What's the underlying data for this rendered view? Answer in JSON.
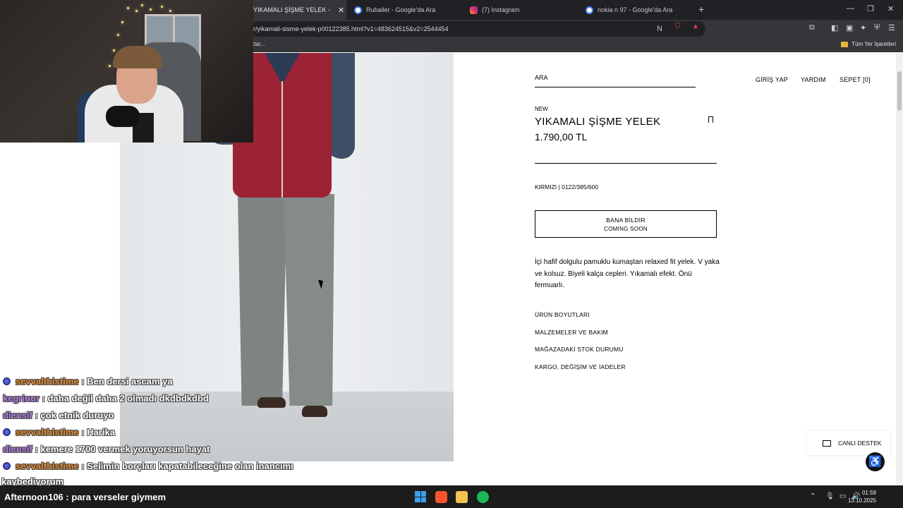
{
  "browser": {
    "tabs": [
      {
        "title": "YIKAMALI ŞİŞME YELEK - Kırmızı",
        "active": true
      },
      {
        "title": "Rubailer - Google'da Ara",
        "active": false
      },
      {
        "title": "(7) Instagram",
        "active": false
      },
      {
        "title": "nokia n 97 - Google'da Ara",
        "active": false
      }
    ],
    "new_tab": "+",
    "url": "r/yikamali-sisme-yelek-p00122385.html?v1=483624515&v2=2544454",
    "bookmark_left": "ttar...",
    "bookmarks_folder": "Tüm Yer İşaretleri"
  },
  "product": {
    "search_label": "ARA",
    "nav": {
      "login": "GİRİŞ YAP",
      "help": "YARDIM",
      "cart": "SEPET [0]"
    },
    "tag": "NEW",
    "title": "YIKAMALI ŞİŞME YELEK",
    "price": "1.790,00 TL",
    "color_code": "KIRMIZI | 0122/385/600",
    "notify_line1": "BANA BİLDİR",
    "notify_line2": "COMING SOON",
    "description": "İçi hafif dolgulu pamuklu kumaştan relaxed fit yelek. V yaka ve kolsuz. Biyeli kalça cepleri. Yıkamalı efekt. Önü fermuarlı.",
    "accordion": [
      "ÜRÜN BOYUTLARI",
      "MALZEMELER VE BAKIM",
      "MAĞAZADAKİ STOK DURUMU",
      "KARGO, DEĞİŞİM VE İADELER"
    ],
    "support_label": "CANLI DESTEK"
  },
  "chat": [
    {
      "user": "sevvalthistime",
      "msg": ": Ben dersi ascam ya",
      "badge": true,
      "color": "orange"
    },
    {
      "user": "kegrinur",
      "msg": ": daha değil daha 2 olmadı dkdbdkdbd",
      "badge": false,
      "color": "purple"
    },
    {
      "user": "diensif",
      "msg": ": çok etnik duruyo",
      "badge": false,
      "color": "purple"
    },
    {
      "user": "sevvalthistime",
      "msg": ": Harika",
      "badge": true,
      "color": "orange"
    },
    {
      "user": "diensif",
      "msg": ": kemere 1700 vermek yoruyorsun hayat",
      "badge": false,
      "color": "purple"
    },
    {
      "user": "sevvalthistime",
      "msg": ": Selimin borçları kapatabileceğine olan inancımı",
      "badge": true,
      "color": "orange"
    },
    {
      "user": "",
      "msg": "kaybediyorum",
      "badge": false,
      "color": "white"
    }
  ],
  "taskbar": {
    "chat_user": "Afternoon106",
    "chat_msg": " : para verseler giymem",
    "time": "01:59",
    "date": "13.10.2025"
  },
  "colors": {
    "chrome_dark": "#202124",
    "chrome_mid": "#35363a",
    "vest_red": "#9c2334",
    "chat_orange": "#e08a2e",
    "chat_purple": "#b07be0"
  }
}
